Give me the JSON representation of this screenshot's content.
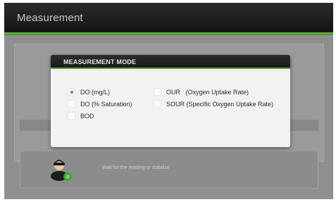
{
  "header": {
    "title": "Measurement"
  },
  "dialog": {
    "title": "MEASUREMENT MODE",
    "options": [
      {
        "label": "DO (mg/L)",
        "selected": true
      },
      {
        "label": "DO (% Saturation)",
        "selected": false
      },
      {
        "label": "BOD",
        "selected": false
      },
      {
        "label": "OUR   (Oxygen Uptake Rate)",
        "selected": false
      },
      {
        "label": "SOUR (Specific Oxygen Uptake Rate)",
        "selected": false
      }
    ]
  },
  "status": {
    "icon": "user-wait-icon",
    "text": "Wait for the reading to stabilize"
  },
  "colors": {
    "accent": "#5aa83a",
    "header_bg": "#1a1a1a",
    "screen_bg": "#8f8f8f"
  }
}
